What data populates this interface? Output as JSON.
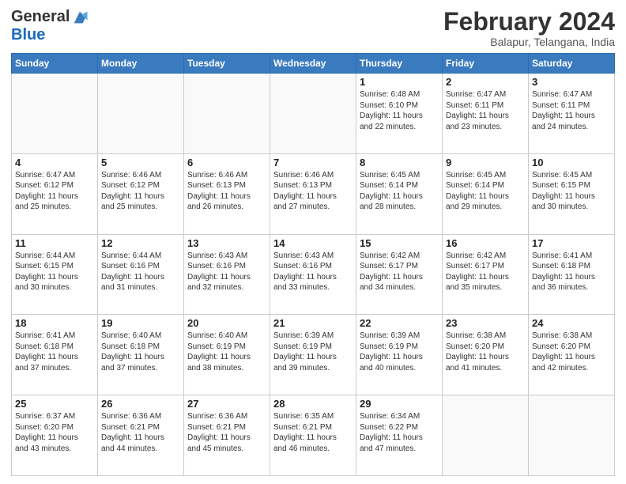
{
  "logo": {
    "general": "General",
    "blue": "Blue"
  },
  "header": {
    "month_year": "February 2024",
    "location": "Balapur, Telangana, India"
  },
  "days_of_week": [
    "Sunday",
    "Monday",
    "Tuesday",
    "Wednesday",
    "Thursday",
    "Friday",
    "Saturday"
  ],
  "weeks": [
    [
      {
        "day": "",
        "info": ""
      },
      {
        "day": "",
        "info": ""
      },
      {
        "day": "",
        "info": ""
      },
      {
        "day": "",
        "info": ""
      },
      {
        "day": "1",
        "info": "Sunrise: 6:48 AM\nSunset: 6:10 PM\nDaylight: 11 hours\nand 22 minutes."
      },
      {
        "day": "2",
        "info": "Sunrise: 6:47 AM\nSunset: 6:11 PM\nDaylight: 11 hours\nand 23 minutes."
      },
      {
        "day": "3",
        "info": "Sunrise: 6:47 AM\nSunset: 6:11 PM\nDaylight: 11 hours\nand 24 minutes."
      }
    ],
    [
      {
        "day": "4",
        "info": "Sunrise: 6:47 AM\nSunset: 6:12 PM\nDaylight: 11 hours\nand 25 minutes."
      },
      {
        "day": "5",
        "info": "Sunrise: 6:46 AM\nSunset: 6:12 PM\nDaylight: 11 hours\nand 25 minutes."
      },
      {
        "day": "6",
        "info": "Sunrise: 6:46 AM\nSunset: 6:13 PM\nDaylight: 11 hours\nand 26 minutes."
      },
      {
        "day": "7",
        "info": "Sunrise: 6:46 AM\nSunset: 6:13 PM\nDaylight: 11 hours\nand 27 minutes."
      },
      {
        "day": "8",
        "info": "Sunrise: 6:45 AM\nSunset: 6:14 PM\nDaylight: 11 hours\nand 28 minutes."
      },
      {
        "day": "9",
        "info": "Sunrise: 6:45 AM\nSunset: 6:14 PM\nDaylight: 11 hours\nand 29 minutes."
      },
      {
        "day": "10",
        "info": "Sunrise: 6:45 AM\nSunset: 6:15 PM\nDaylight: 11 hours\nand 30 minutes."
      }
    ],
    [
      {
        "day": "11",
        "info": "Sunrise: 6:44 AM\nSunset: 6:15 PM\nDaylight: 11 hours\nand 30 minutes."
      },
      {
        "day": "12",
        "info": "Sunrise: 6:44 AM\nSunset: 6:16 PM\nDaylight: 11 hours\nand 31 minutes."
      },
      {
        "day": "13",
        "info": "Sunrise: 6:43 AM\nSunset: 6:16 PM\nDaylight: 11 hours\nand 32 minutes."
      },
      {
        "day": "14",
        "info": "Sunrise: 6:43 AM\nSunset: 6:16 PM\nDaylight: 11 hours\nand 33 minutes."
      },
      {
        "day": "15",
        "info": "Sunrise: 6:42 AM\nSunset: 6:17 PM\nDaylight: 11 hours\nand 34 minutes."
      },
      {
        "day": "16",
        "info": "Sunrise: 6:42 AM\nSunset: 6:17 PM\nDaylight: 11 hours\nand 35 minutes."
      },
      {
        "day": "17",
        "info": "Sunrise: 6:41 AM\nSunset: 6:18 PM\nDaylight: 11 hours\nand 36 minutes."
      }
    ],
    [
      {
        "day": "18",
        "info": "Sunrise: 6:41 AM\nSunset: 6:18 PM\nDaylight: 11 hours\nand 37 minutes."
      },
      {
        "day": "19",
        "info": "Sunrise: 6:40 AM\nSunset: 6:18 PM\nDaylight: 11 hours\nand 37 minutes."
      },
      {
        "day": "20",
        "info": "Sunrise: 6:40 AM\nSunset: 6:19 PM\nDaylight: 11 hours\nand 38 minutes."
      },
      {
        "day": "21",
        "info": "Sunrise: 6:39 AM\nSunset: 6:19 PM\nDaylight: 11 hours\nand 39 minutes."
      },
      {
        "day": "22",
        "info": "Sunrise: 6:39 AM\nSunset: 6:19 PM\nDaylight: 11 hours\nand 40 minutes."
      },
      {
        "day": "23",
        "info": "Sunrise: 6:38 AM\nSunset: 6:20 PM\nDaylight: 11 hours\nand 41 minutes."
      },
      {
        "day": "24",
        "info": "Sunrise: 6:38 AM\nSunset: 6:20 PM\nDaylight: 11 hours\nand 42 minutes."
      }
    ],
    [
      {
        "day": "25",
        "info": "Sunrise: 6:37 AM\nSunset: 6:20 PM\nDaylight: 11 hours\nand 43 minutes."
      },
      {
        "day": "26",
        "info": "Sunrise: 6:36 AM\nSunset: 6:21 PM\nDaylight: 11 hours\nand 44 minutes."
      },
      {
        "day": "27",
        "info": "Sunrise: 6:36 AM\nSunset: 6:21 PM\nDaylight: 11 hours\nand 45 minutes."
      },
      {
        "day": "28",
        "info": "Sunrise: 6:35 AM\nSunset: 6:21 PM\nDaylight: 11 hours\nand 46 minutes."
      },
      {
        "day": "29",
        "info": "Sunrise: 6:34 AM\nSunset: 6:22 PM\nDaylight: 11 hours\nand 47 minutes."
      },
      {
        "day": "",
        "info": ""
      },
      {
        "day": "",
        "info": ""
      }
    ]
  ]
}
